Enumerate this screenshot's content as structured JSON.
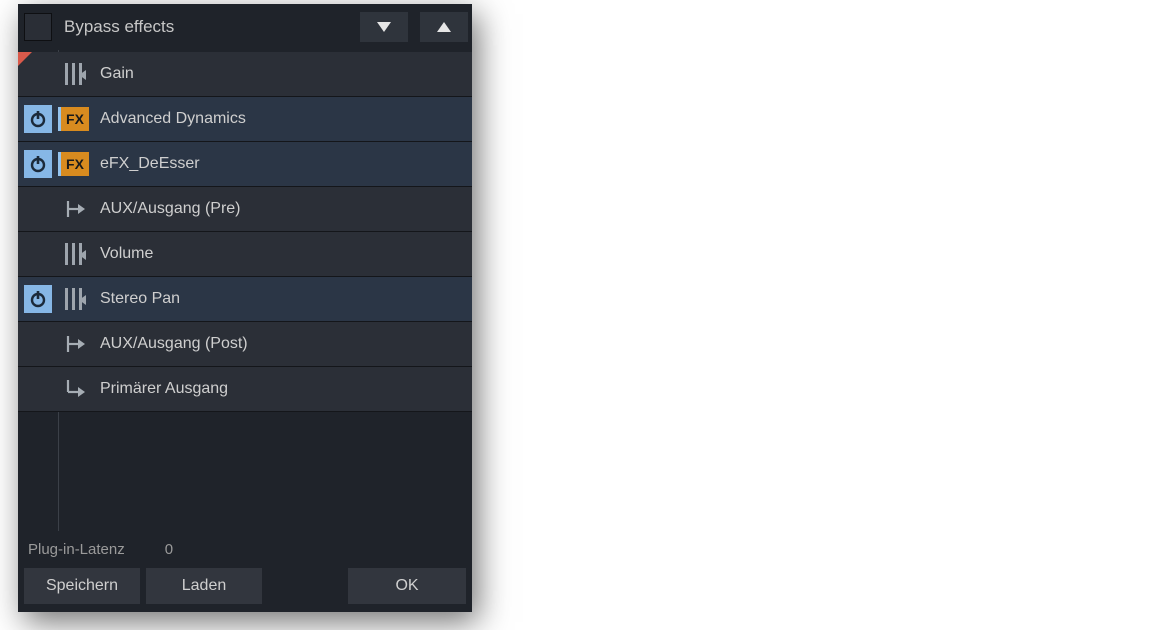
{
  "header": {
    "title": "Bypass effects"
  },
  "rows": [
    {
      "label": "Gain",
      "power": false,
      "fx": false,
      "icon": "slider",
      "bg": "dark",
      "redMarker": true
    },
    {
      "label": "Advanced Dynamics",
      "power": true,
      "fx": true,
      "icon": null,
      "bg": "blue",
      "fxText": "FX"
    },
    {
      "label": "eFX_DeEsser",
      "power": true,
      "fx": true,
      "icon": null,
      "bg": "blue",
      "fxText": "FX"
    },
    {
      "label": "AUX/Ausgang (Pre)",
      "power": false,
      "fx": false,
      "icon": "send",
      "bg": "dark"
    },
    {
      "label": "Volume",
      "power": false,
      "fx": false,
      "icon": "slider",
      "bg": "dark"
    },
    {
      "label": "Stereo Pan",
      "power": true,
      "fx": false,
      "icon": "slider",
      "bg": "blue"
    },
    {
      "label": "AUX/Ausgang (Post)",
      "power": false,
      "fx": false,
      "icon": "send",
      "bg": "dark"
    },
    {
      "label": "Primärer Ausgang",
      "power": false,
      "fx": false,
      "icon": "out",
      "bg": "dark"
    }
  ],
  "footer": {
    "latency_label": "Plug-in-Latenz",
    "latency_value": "0",
    "save": "Speichern",
    "load": "Laden",
    "ok": "OK"
  }
}
